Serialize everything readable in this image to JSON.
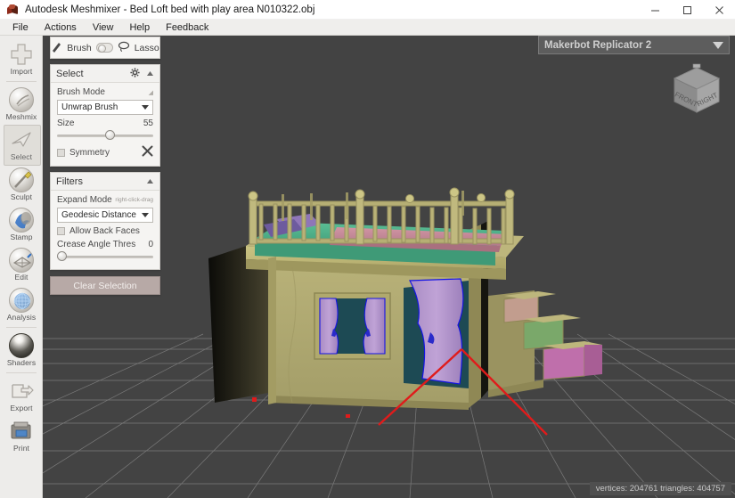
{
  "window": {
    "title": "Autodesk Meshmixer - Bed Loft bed with play area N010322.obj",
    "app_icon": "meshmixer-logo-icon",
    "minimize_label": "–",
    "maximize_label": "□",
    "close_label": "✕"
  },
  "menu": {
    "items": [
      {
        "label": "File"
      },
      {
        "label": "Actions"
      },
      {
        "label": "View"
      },
      {
        "label": "Help"
      },
      {
        "label": "Feedback"
      }
    ]
  },
  "toolbar": {
    "items": [
      {
        "label": "Import",
        "icon": "plus-icon",
        "selected": false
      },
      {
        "label": "Meshmix",
        "icon": "meshmix-orb-icon",
        "selected": false
      },
      {
        "label": "Select",
        "icon": "cursor-arrow-icon",
        "selected": true
      },
      {
        "label": "Sculpt",
        "icon": "brush-orb-icon",
        "selected": false
      },
      {
        "label": "Stamp",
        "icon": "stamp-orb-icon",
        "selected": false
      },
      {
        "label": "Edit",
        "icon": "edit-orb-icon",
        "selected": false
      },
      {
        "label": "Analysis",
        "icon": "analysis-orb-icon",
        "selected": false
      },
      {
        "label": "Shaders",
        "icon": "shader-sphere-icon",
        "selected": false
      },
      {
        "label": "Export",
        "icon": "export-arrow-icon",
        "selected": false
      },
      {
        "label": "Print",
        "icon": "printer-icon",
        "selected": false
      }
    ]
  },
  "brush_bar": {
    "brush_label": "Brush",
    "lasso_label": "Lasso",
    "brush_icon": "paintbrush-icon",
    "lasso_icon": "lasso-icon",
    "toggle_state": "brush"
  },
  "select_panel": {
    "title": "Select",
    "gear_icon": "gear-icon",
    "collapse_icon": "chevron-up-icon",
    "brush_mode_label": "Brush Mode",
    "brush_mode_value": "Unwrap Brush",
    "size_label": "Size",
    "size_value": "55",
    "size_percent": 55,
    "symmetry_label": "Symmetry",
    "symmetry_checked": false,
    "symmetry_tool_icon": "cross-tool-icon"
  },
  "filters_panel": {
    "title": "Filters",
    "collapse_icon": "chevron-up-icon",
    "expand_mode_label": "Expand Mode",
    "expand_mode_hint": "right-click-drag",
    "expand_mode_value": "Geodesic Distance",
    "allow_back_faces_label": "Allow Back Faces",
    "allow_back_faces_checked": false,
    "crease_angle_label": "Crease Angle Thres",
    "crease_angle_value": "0",
    "crease_angle_percent": 0
  },
  "actions": {
    "clear_selection_label": "Clear Selection"
  },
  "viewport": {
    "printer_label": "Makerbot Replicator 2",
    "printer_caret_icon": "chevron-down-icon",
    "viewcube_front_label": "FRONT",
    "viewcube_right_label": "RIGHT",
    "status_text": "vertices: 204761 triangles: 404757",
    "background_color": "#434343",
    "grid_line_color": "#9a9a9a",
    "axis_color": "#e01b1b",
    "model_name": "loft-bed-with-play-area"
  },
  "colors": {
    "window_chrome": "#efeeec",
    "panel_bg": "#f2f1ef",
    "accent_button": "#b7a9a6",
    "model_wood": "#b5ae72",
    "model_mattress": "#4fae8a",
    "model_blanket": "#c98a9a",
    "model_curtain": "#b48fc9",
    "selection_outline": "#1414e6"
  }
}
